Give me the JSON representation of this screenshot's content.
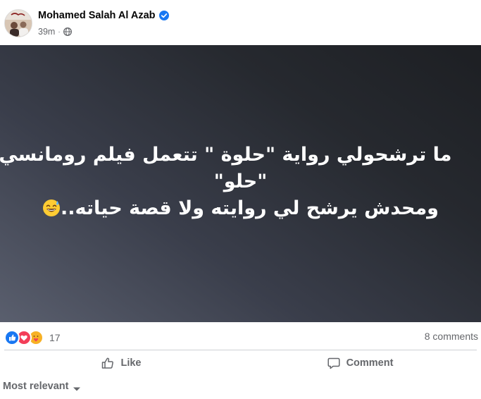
{
  "post": {
    "author": "Mohamed Salah Al Azab",
    "time": "39m",
    "separator": "·",
    "text_lines": [
      "ما ترشحولي رواية \"حلوة \" تتعمل فيلم رومانسي",
      "\"حلو\"",
      "ومحدش يرشح لي روايته ولا قصة حياته.."
    ],
    "inline_emoji": "grinning-sweat-emoji",
    "background_colors": [
      "#5a5f6e",
      "#1d1f23"
    ]
  },
  "stats": {
    "reaction_icons": [
      "like-icon",
      "love-icon",
      "care-icon"
    ],
    "reaction_count": "17",
    "comments": "8 comments"
  },
  "actions": {
    "like_label": "Like",
    "comment_label": "Comment"
  },
  "sort": {
    "label": "Most relevant"
  },
  "colors": {
    "like_blue": "#1877f2",
    "love_red": "#f33e58",
    "care_yellow": "#f7b125",
    "secondary_text": "#65676b"
  }
}
